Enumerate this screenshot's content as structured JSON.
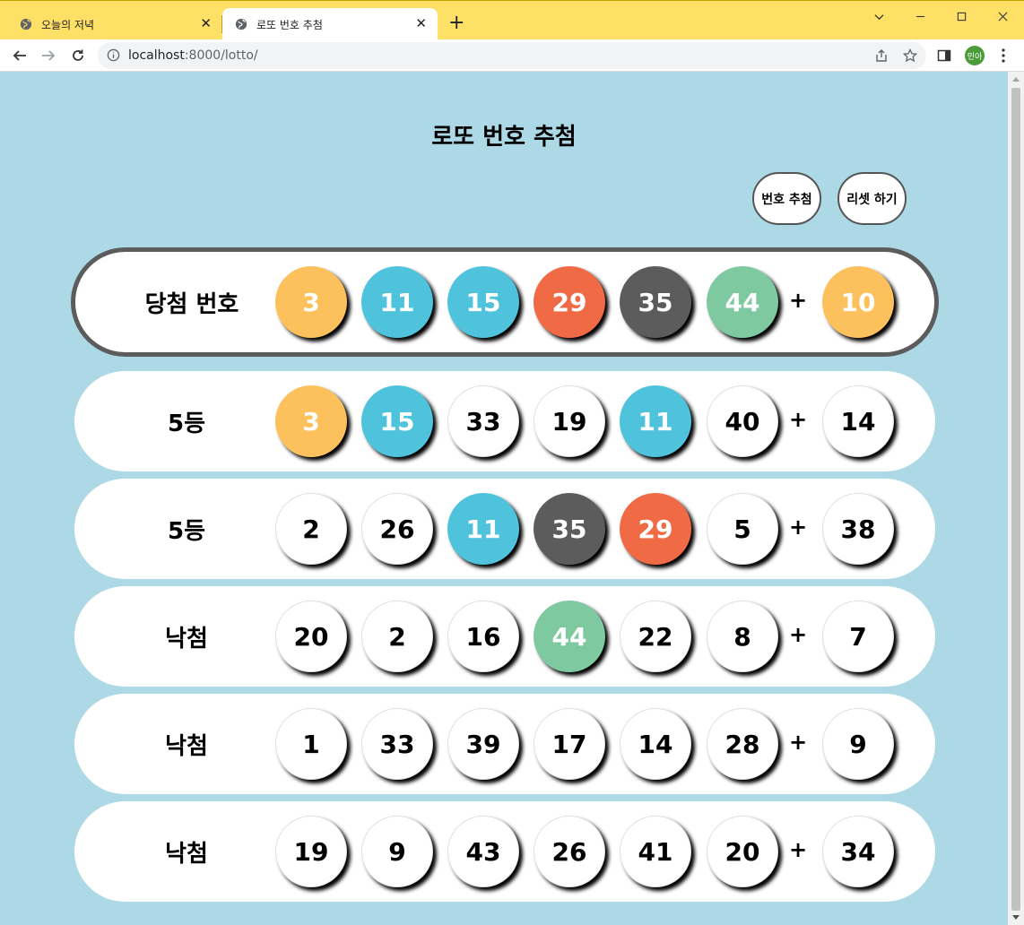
{
  "browser": {
    "tabs": [
      {
        "title": "오늘의 저녁",
        "icon": "globe-icon",
        "active": false
      },
      {
        "title": "로또 번호 추첨",
        "icon": "globe-icon",
        "active": true
      }
    ],
    "url_host": "localhost",
    "url_path": ":8000/lotto/",
    "profile_initials": "민아",
    "accent_color": "#ffe066"
  },
  "page": {
    "title": "로또 번호 추첨",
    "buttons": {
      "draw": "번호 추첨",
      "reset": "리셋 하기"
    },
    "plus_sign": "+",
    "ball_colors": {
      "yellow": "#fcc05c",
      "blue": "#4ec3db",
      "red": "#f06a45",
      "gray": "#5c5c5c",
      "green": "#7ec9a0",
      "white": "#ffffff"
    },
    "rows": [
      {
        "label": "당첨 번호",
        "winning": true,
        "balls": [
          {
            "n": "3",
            "color": "yellow"
          },
          {
            "n": "11",
            "color": "blue"
          },
          {
            "n": "15",
            "color": "blue"
          },
          {
            "n": "29",
            "color": "red"
          },
          {
            "n": "35",
            "color": "gray"
          },
          {
            "n": "44",
            "color": "green"
          }
        ],
        "bonus": {
          "n": "10",
          "color": "yellow"
        }
      },
      {
        "label": "5등",
        "winning": false,
        "balls": [
          {
            "n": "3",
            "color": "yellow"
          },
          {
            "n": "15",
            "color": "blue"
          },
          {
            "n": "33",
            "color": "white"
          },
          {
            "n": "19",
            "color": "white"
          },
          {
            "n": "11",
            "color": "blue"
          },
          {
            "n": "40",
            "color": "white"
          }
        ],
        "bonus": {
          "n": "14",
          "color": "white"
        }
      },
      {
        "label": "5등",
        "winning": false,
        "balls": [
          {
            "n": "2",
            "color": "white"
          },
          {
            "n": "26",
            "color": "white"
          },
          {
            "n": "11",
            "color": "blue"
          },
          {
            "n": "35",
            "color": "gray"
          },
          {
            "n": "29",
            "color": "red"
          },
          {
            "n": "5",
            "color": "white"
          }
        ],
        "bonus": {
          "n": "38",
          "color": "white"
        }
      },
      {
        "label": "낙첨",
        "winning": false,
        "balls": [
          {
            "n": "20",
            "color": "white"
          },
          {
            "n": "2",
            "color": "white"
          },
          {
            "n": "16",
            "color": "white"
          },
          {
            "n": "44",
            "color": "green"
          },
          {
            "n": "22",
            "color": "white"
          },
          {
            "n": "8",
            "color": "white"
          }
        ],
        "bonus": {
          "n": "7",
          "color": "white"
        }
      },
      {
        "label": "낙첨",
        "winning": false,
        "balls": [
          {
            "n": "1",
            "color": "white"
          },
          {
            "n": "33",
            "color": "white"
          },
          {
            "n": "39",
            "color": "white"
          },
          {
            "n": "17",
            "color": "white"
          },
          {
            "n": "14",
            "color": "white"
          },
          {
            "n": "28",
            "color": "white"
          }
        ],
        "bonus": {
          "n": "9",
          "color": "white"
        }
      },
      {
        "label": "낙첨",
        "winning": false,
        "balls": [
          {
            "n": "19",
            "color": "white"
          },
          {
            "n": "9",
            "color": "white"
          },
          {
            "n": "43",
            "color": "white"
          },
          {
            "n": "26",
            "color": "white"
          },
          {
            "n": "41",
            "color": "white"
          },
          {
            "n": "20",
            "color": "white"
          }
        ],
        "bonus": {
          "n": "34",
          "color": "white"
        }
      }
    ]
  }
}
